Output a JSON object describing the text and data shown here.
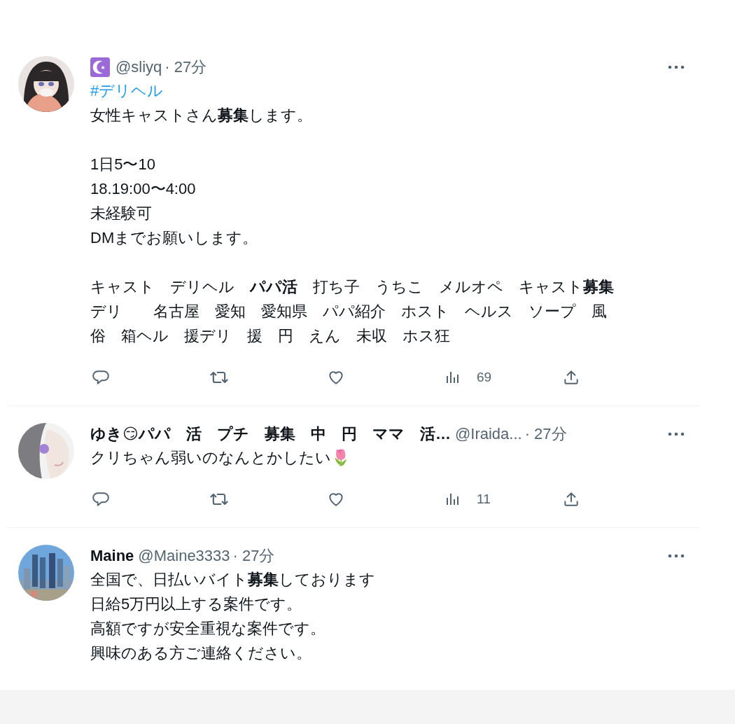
{
  "tweets": [
    {
      "avatar": {
        "kind": "picture"
      },
      "badge": true,
      "handle": "@sliyq",
      "time": "· 27分",
      "hashtag": "#デリヘル",
      "paragraphs": [
        [
          "女性キャストさん**募集**します。"
        ],
        [
          "1日5〜10",
          "18.19:00〜4:00",
          "未経験可",
          "DMまでお願いします。"
        ],
        [
          "キャスト　デリヘル　**パパ活**　打ち子　うちこ　メルオペ　キャスト**募集**",
          "デリ　　名古屋　愛知　愛知県　パパ紹介　ホスト　ヘルス　ソープ　風",
          "俗　箱ヘル　援デリ　援　円　えん　未収　ホス狂"
        ]
      ],
      "views": "69"
    },
    {
      "avatar": {
        "kind": "picture"
      },
      "badge": false,
      "name": "ゆき😏パパ　活　プチ　募集　中　円　ママ　活…",
      "handle": "@Iraida...",
      "time": "· 27分",
      "paragraphs": [
        [
          "クリちゃん弱いのなんとかしたい🌷"
        ]
      ],
      "views": "11"
    },
    {
      "avatar": {
        "kind": "picture"
      },
      "badge": false,
      "name": "Maine",
      "handle": "@Maine3333",
      "time": "· 27分",
      "paragraphs": [
        [
          "全国で、日払いバイト**募集**しております",
          "日給5万円以上する案件です。",
          "高額ですが安全重視な案件です。",
          "興味のある方ご連絡ください。"
        ]
      ]
    }
  ]
}
